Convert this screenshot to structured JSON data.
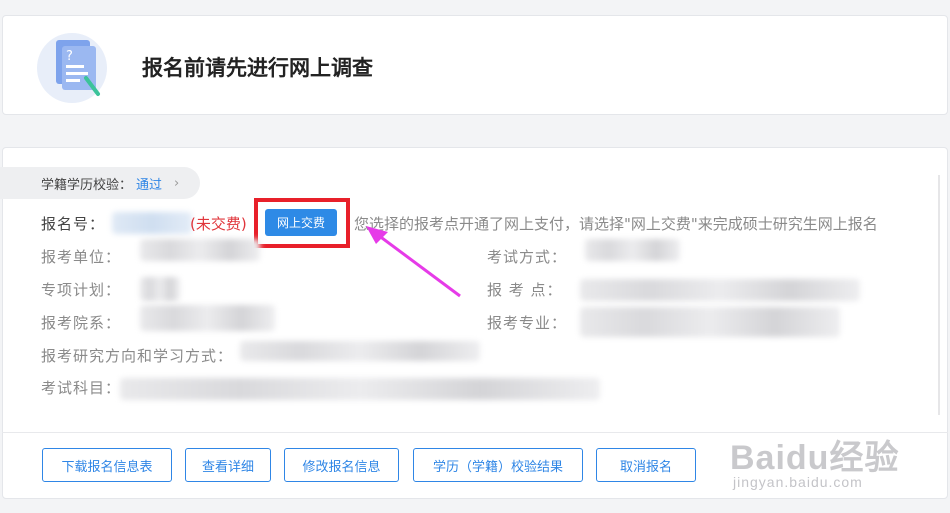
{
  "survey": {
    "title": "报名前请先进行网上调查",
    "icon": "survey-document-icon"
  },
  "verification": {
    "label": "学籍学历校验：",
    "status": "通过"
  },
  "registration": {
    "number_label": "报名号：",
    "payment_status": "(未交费)",
    "pay_button": "网上交费",
    "pay_note": "您选择的报考点开通了网上支付，请选择\"网上交费\"来完成硕士研究生网上报名"
  },
  "fields": {
    "unit": "报考单位：",
    "exam_method": "考试方式：",
    "special_plan": "专项计划：",
    "exam_site": "报 考 点：",
    "department": "报考院系：",
    "major": "报考专业：",
    "direction": "报考研究方向和学习方式：",
    "subjects": "考试科目："
  },
  "actions": {
    "download": "下载报名信息表",
    "details": "查看详细",
    "modify": "修改报名信息",
    "verify_result": "学历（学籍）校验结果",
    "cancel": "取消报名"
  },
  "watermark": {
    "brand": "Baidu经验",
    "url": "jingyan.baidu.com"
  },
  "colors": {
    "accent": "#2f86e6",
    "danger": "#e0353b",
    "highlight": "#e8202a",
    "arrow": "#e63be8"
  }
}
